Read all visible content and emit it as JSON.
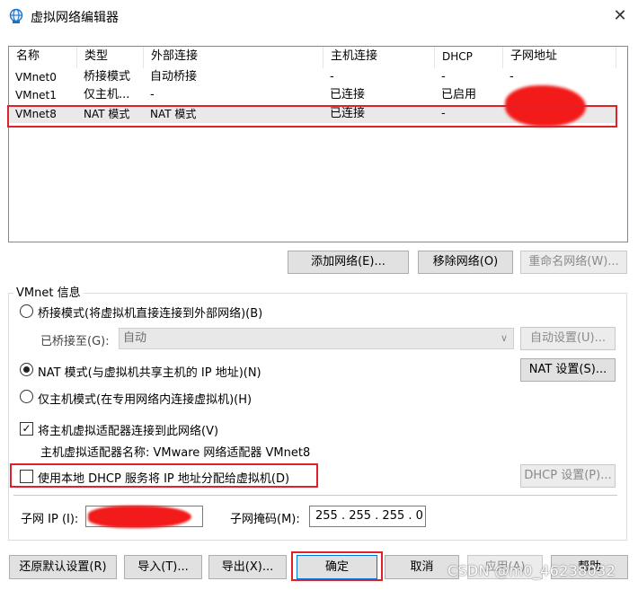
{
  "window": {
    "title": "虚拟网络编辑器",
    "close": "✕"
  },
  "list": {
    "columns": [
      "名称",
      "类型",
      "外部连接",
      "主机连接",
      "DHCP",
      "子网地址"
    ],
    "rows": [
      {
        "name": "VMnet0",
        "type": "桥接模式",
        "external": "自动桥接",
        "host": "-",
        "dhcp": "-",
        "subnet": "-"
      },
      {
        "name": "VMnet1",
        "type": "仅主机...",
        "external": "-",
        "host": "已连接",
        "dhcp": "已启用",
        "subnet": ""
      },
      {
        "name": "VMnet8",
        "type": "NAT 模式",
        "external": "NAT 模式",
        "host": "已连接",
        "dhcp": "-",
        "subnet": ""
      }
    ],
    "selected_row": 2
  },
  "list_buttons": {
    "add": "添加网络(E)...",
    "remove": "移除网络(O)",
    "rename": "重命名网络(W)..."
  },
  "info": {
    "group_title": "VMnet 信息",
    "bridged_label": "桥接模式(将虚拟机直接连接到外部网络)(B)",
    "bridged_to_label": "已桥接至(G):",
    "bridged_to_value": "自动",
    "auto_settings": "自动设置(U)...",
    "nat_label": "NAT 模式(与虚拟机共享主机的 IP 地址)(N)",
    "nat_settings": "NAT 设置(S)...",
    "hostonly_label": "仅主机模式(在专用网络内连接虚拟机)(H)",
    "connect_adapter_label": "将主机虚拟适配器连接到此网络(V)",
    "adapter_name_label": "主机虚拟适配器名称: VMware 网络适配器 VMnet8",
    "dhcp_label": "使用本地 DHCP 服务将 IP 地址分配给虚拟机(D)",
    "dhcp_settings": "DHCP 设置(P)...",
    "subnet_ip_label": "子网 IP (I):",
    "subnet_ip_value": "",
    "subnet_mask_label": "子网掩码(M):",
    "subnet_mask_value": "255 . 255 . 255 .  0"
  },
  "bottom_buttons": {
    "restore": "还原默认设置(R)",
    "import": "导入(T)...",
    "export": "导出(X)...",
    "ok": "确定",
    "cancel": "取消",
    "apply": "应用(A)",
    "help": "帮助"
  },
  "watermark": "CSDN @m0_46238032",
  "colors": {
    "annotation_red": "#e0202a",
    "accent_icon": "#1a73c9"
  }
}
